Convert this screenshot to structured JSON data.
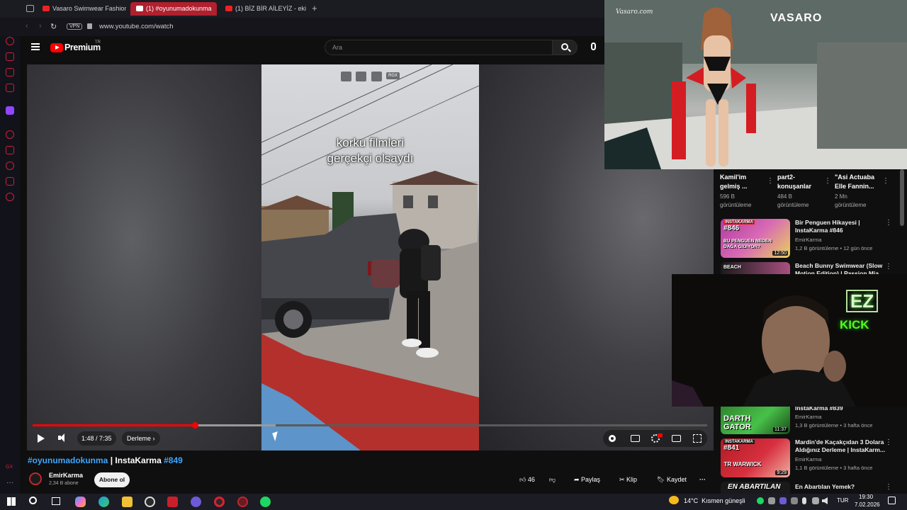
{
  "browser": {
    "tabs": [
      {
        "label": "Vasaro Swimwear Fashion",
        "active": false
      },
      {
        "label": "(1) #oyunumadokunma",
        "active": true
      },
      {
        "label": "(1) BİZ BİR AİLEYİZ - ekip",
        "active": false
      }
    ],
    "vpn_label": "VPN",
    "url": "www.youtube.com/watch"
  },
  "youtube": {
    "logo_text": "Premium",
    "logo_badge": "TR",
    "search_placeholder": "Ara"
  },
  "player": {
    "caption_line1": "korku filmleri",
    "caption_line2": "gerçekçi olsaydı",
    "time": "1:48 / 7:35",
    "chapter": "Derleme",
    "overlay_badge": "RGX",
    "progress_fraction": 0.241
  },
  "video": {
    "title_hashtag": "#oyunumadokunma",
    "title_mid": " | InstaKarma ",
    "title_number": "#849",
    "channel": "EmirKarma",
    "subscribers": "2,34 B abone",
    "subscribe_label": "Abone ol",
    "likes": "46",
    "share_label": "Paylaş",
    "clip_label": "Klip",
    "save_label": "Kaydet"
  },
  "shorts": [
    {
      "title1": "Kamil'im",
      "title2": "gelmiş ...",
      "views1": "596 B",
      "views2": "görüntüleme"
    },
    {
      "title1": "part2-",
      "title2": "konuşanlar",
      "views1": "484 B",
      "views2": "görüntüleme"
    },
    {
      "title1": "\"Asi Actuaba",
      "title2": "Elle Fannin...",
      "views1": "2 Mn",
      "views2": "görüntüleme"
    }
  ],
  "recommendations": [
    {
      "title": "Bir Penguen Hikayesi | InstaKarma #846",
      "channel": "EmirKarma",
      "meta": "1,2 B görüntüleme • 12 gün önce",
      "duration": "12:50",
      "thumb_tag": "INSTAKARMA",
      "thumb_num": "#846",
      "thumb_text": "BU PENGUEN NEDEN DAĞA GİDİYOR?"
    },
    {
      "title": "Beach Bunny Swimwear (Slow Motion Edition) | Passion Mia...",
      "channel": "",
      "meta": "",
      "duration": "",
      "thumb_tag": "BEACH",
      "thumb_num": "",
      "thumb_text": ""
    },
    {
      "title": "InstaKarma #839",
      "channel": "EmirKarma",
      "meta": "1,3 B görüntüleme • 3 hafta önce",
      "duration": "11:37",
      "thumb_tag": "",
      "thumb_num": "#839",
      "thumb_text": "DARTH GATOR"
    },
    {
      "title": "Mardin'de Kaçakçıdan 3 Dolara Aldığınız Derleme | InstaKarm...",
      "channel": "EmirKarma",
      "meta": "1,1 B görüntüleme • 3 hafta önce",
      "duration": "9:29",
      "thumb_tag": "INSTAKARMA",
      "thumb_num": "#841",
      "thumb_text": "TR WARWICK"
    },
    {
      "title": "En Abartılan Yemek?",
      "channel": "",
      "meta": "",
      "duration": "",
      "thumb_tag": "",
      "thumb_num": "",
      "thumb_text": "EN ABARTILAN"
    }
  ],
  "overlays": {
    "runway_brand": "VASARO",
    "runway_watermark": "Vasaro.com",
    "webcam_badge1": "EZ",
    "webcam_badge2": "KICK"
  },
  "taskbar": {
    "weather": "14°C  Kısmen güneşli",
    "lang": "TUR",
    "time": "19:30",
    "date": "7.02.2026"
  },
  "colors": {
    "accent_red": "#ff0000",
    "link_blue": "#3ea6ff",
    "kick_green": "#53fc18"
  }
}
